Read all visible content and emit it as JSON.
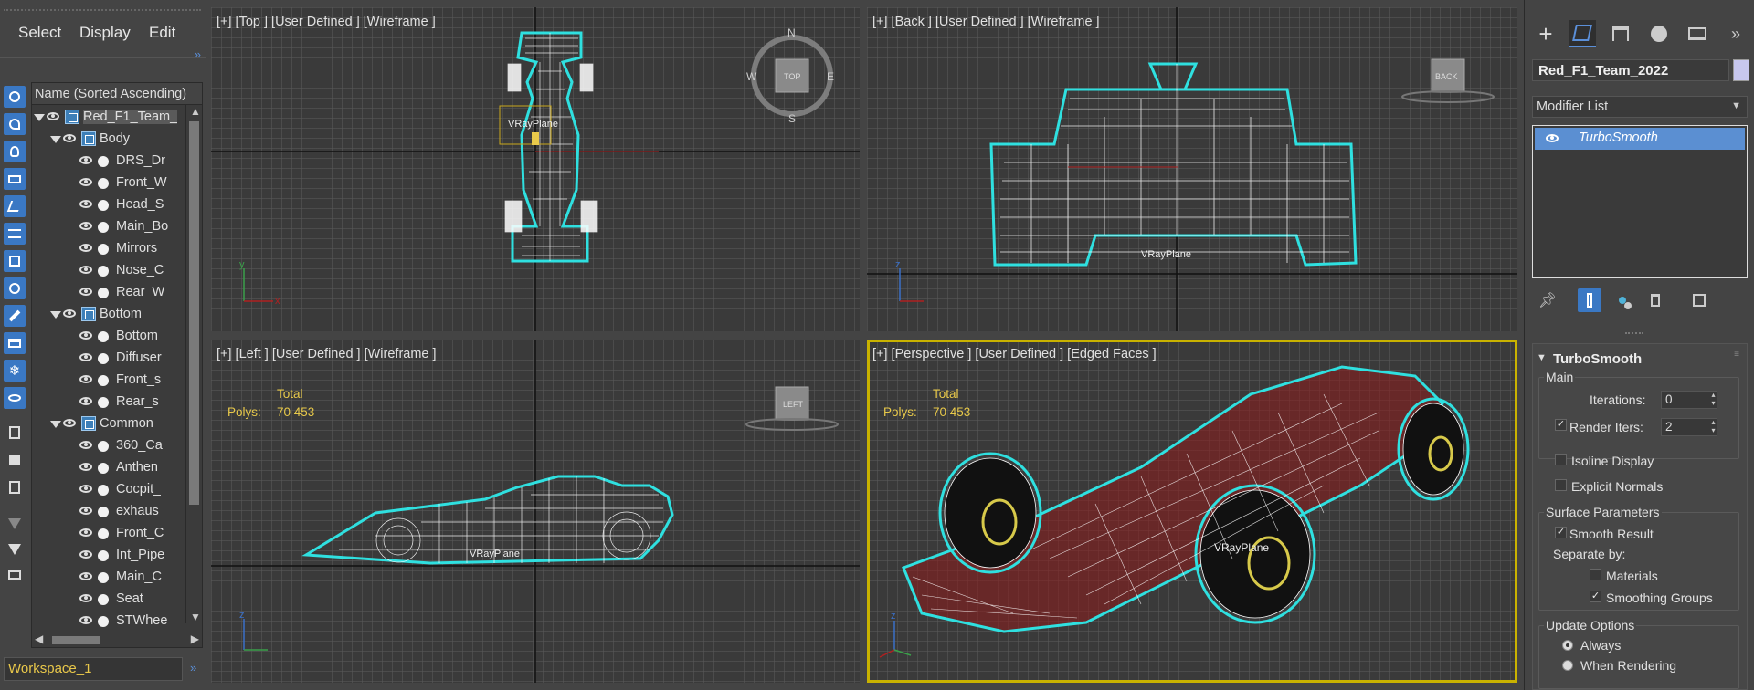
{
  "menu": {
    "select": "Select",
    "display": "Display",
    "edit": "Edit"
  },
  "explorer": {
    "column_header": "Name (Sorted Ascending)",
    "rows": [
      {
        "label": "Red_F1_Team_",
        "level": 0,
        "expanded": true,
        "type": "group",
        "selected": true
      },
      {
        "label": "Body",
        "level": 1,
        "expanded": true,
        "type": "group"
      },
      {
        "label": "DRS_Dr",
        "level": 2,
        "type": "object"
      },
      {
        "label": "Front_W",
        "level": 2,
        "type": "object"
      },
      {
        "label": "Head_S",
        "level": 2,
        "type": "object"
      },
      {
        "label": "Main_Bo",
        "level": 2,
        "type": "object"
      },
      {
        "label": "Mirrors",
        "level": 2,
        "type": "object"
      },
      {
        "label": "Nose_C",
        "level": 2,
        "type": "object"
      },
      {
        "label": "Rear_W",
        "level": 2,
        "type": "object"
      },
      {
        "label": "Bottom",
        "level": 1,
        "expanded": true,
        "type": "group"
      },
      {
        "label": "Bottom",
        "level": 2,
        "type": "object"
      },
      {
        "label": "Diffuser",
        "level": 2,
        "type": "object"
      },
      {
        "label": "Front_s",
        "level": 2,
        "type": "object"
      },
      {
        "label": "Rear_s",
        "level": 2,
        "type": "object"
      },
      {
        "label": "Common",
        "level": 1,
        "expanded": true,
        "type": "group"
      },
      {
        "label": "360_Ca",
        "level": 2,
        "type": "object"
      },
      {
        "label": "Anthen",
        "level": 2,
        "type": "object"
      },
      {
        "label": "Cocpit_",
        "level": 2,
        "type": "object"
      },
      {
        "label": "exhaus",
        "level": 2,
        "type": "object"
      },
      {
        "label": "Front_C",
        "level": 2,
        "type": "object"
      },
      {
        "label": "Int_Pipe",
        "level": 2,
        "type": "object"
      },
      {
        "label": "Main_C",
        "level": 2,
        "type": "object"
      },
      {
        "label": "Seat",
        "level": 2,
        "type": "object"
      },
      {
        "label": "STWhee",
        "level": 2,
        "type": "object"
      }
    ],
    "workspace": "Workspace_1"
  },
  "viewports": {
    "top": {
      "label": "[+] [Top ] [User Defined ] [Wireframe ]",
      "plane": "VRayPlane",
      "x_axis": "x",
      "y_axis": "y",
      "compass": {
        "n": "N",
        "s": "S",
        "e": "E",
        "w": "W",
        "cube": "TOP"
      }
    },
    "back": {
      "label": "[+] [Back ] [User Defined ] [Wireframe ]",
      "plane": "VRayPlane",
      "cube": "BACK"
    },
    "left": {
      "label": "[+] [Left ] [User Defined ] [Wireframe ]",
      "plane": "VRayPlane",
      "cube": "LEFT",
      "stats_total": "Total",
      "stats_polys_label": "Polys:",
      "stats_polys_value": "70 453"
    },
    "persp": {
      "label": "[+] [Perspective ] [User Defined ] [Edged Faces ]",
      "plane": "VRayPlane",
      "stats_total": "Total",
      "stats_polys_label": "Polys:",
      "stats_polys_value": "70 453"
    }
  },
  "command_panel": {
    "object_name": "Red_F1_Team_2022",
    "object_color": "#c7c7ef",
    "modifier_list_label": "Modifier List",
    "stack": [
      {
        "name": "TurboSmooth",
        "active": true
      }
    ],
    "rollout": {
      "title": "TurboSmooth",
      "main_label": "Main",
      "iterations_label": "Iterations:",
      "iterations_value": "0",
      "render_iters_label": "Render Iters:",
      "render_iters_value": "2",
      "render_iters_checked": true,
      "isoline_label": "Isoline Display",
      "isoline_checked": false,
      "explicit_normals_label": "Explicit Normals",
      "explicit_normals_checked": false,
      "surface_params_label": "Surface Parameters",
      "smooth_result_label": "Smooth Result",
      "smooth_result_checked": true,
      "separate_by_label": "Separate by:",
      "materials_label": "Materials",
      "materials_checked": false,
      "smoothing_groups_label": "Smoothing Groups",
      "smoothing_groups_checked": true,
      "update_options_label": "Update Options",
      "always_label": "Always",
      "when_rendering_label": "When Rendering",
      "update_selected": "Always"
    }
  },
  "colors": {
    "accent": "#3a78c4",
    "selection_yellow": "#c9b200",
    "stats_yellow": "#e8c94a",
    "wire_cyan": "#2fe0e0",
    "body_red": "#8e1a1a"
  }
}
